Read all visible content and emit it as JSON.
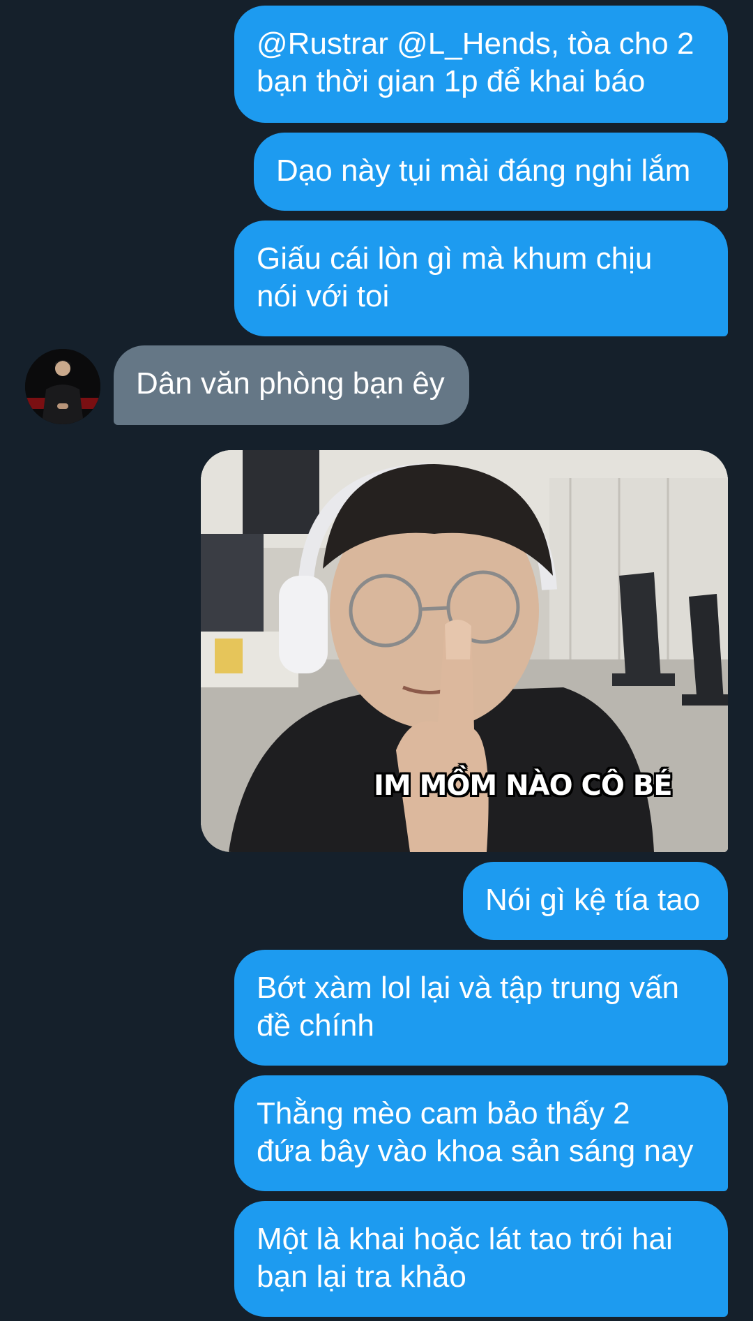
{
  "colors": {
    "background": "#15202b",
    "outgoing_bubble": "#1d9bf0",
    "incoming_bubble": "#657786",
    "text": "#ffffff"
  },
  "messages": [
    {
      "direction": "outgoing",
      "type": "text",
      "text": "@Rustrar @L_Hends, tòa cho 2\nbạn thời gian 1p để khai báo"
    },
    {
      "direction": "outgoing",
      "type": "text",
      "text": "Dạo này tụi mài đáng nghi lắm"
    },
    {
      "direction": "outgoing",
      "type": "text",
      "text": "Giấu cái lòn gì mà khum chịu\nnói với toi"
    },
    {
      "direction": "incoming",
      "type": "text",
      "text": "Dân văn phòng bạn êy"
    },
    {
      "direction": "outgoing",
      "type": "image",
      "caption": "IM MỒM NÀO CÔ BÉ"
    },
    {
      "direction": "outgoing",
      "type": "text",
      "text": "Nói gì kệ tía tao"
    },
    {
      "direction": "outgoing",
      "type": "text",
      "text": "Bớt xàm lol lại và tập trung vấn\nđề chính"
    },
    {
      "direction": "outgoing",
      "type": "text",
      "text": "Thằng mèo cam bảo thấy 2\nđứa bây vào khoa sản sáng nay"
    },
    {
      "direction": "outgoing",
      "type": "text",
      "text": "Một là khai hoặc lát tao trói hai\nbạn lại tra khảo"
    }
  ]
}
